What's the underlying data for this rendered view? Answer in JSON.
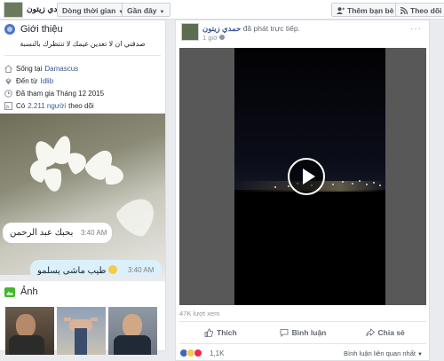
{
  "topbar": {
    "profile_name": "حمدي زيتون",
    "timeline_buttons": [
      "Dòng thời gian",
      "Gần đây"
    ],
    "add_friend": "Thêm bạn bè",
    "follow": "Theo dõi"
  },
  "intro": {
    "title": "Giới thiệu",
    "bio": "صدقني ان لا تعدين غيمك لا تنتظرك بالنسبة",
    "items": [
      {
        "icon": "house-icon",
        "prefix": "Sống tại",
        "link": "Damascus"
      },
      {
        "icon": "pin-icon",
        "prefix": "Đến từ",
        "link": "Idlib"
      },
      {
        "icon": "clock-icon",
        "prefix": "Đã tham gia Tháng 12 2015",
        "link": ""
      },
      {
        "icon": "rss-icon",
        "prefix": "Có",
        "link": "2.211 người",
        "suffix": "theo dõi"
      }
    ]
  },
  "photo_chat": [
    {
      "text": "بحبك عبد الرحمن",
      "time": "3:40 AM"
    },
    {
      "text": "طيب ماشي يسلمو",
      "time": "3:40 AM"
    }
  ],
  "photos": {
    "title": "Ảnh"
  },
  "post": {
    "author": "حمدي زيتون",
    "action": "đã phát trực tiếp.",
    "time": "1 giờ",
    "more": "···",
    "views": "47K lượt xem",
    "actions": [
      "Thích",
      "Bình luận",
      "Chia sẻ"
    ],
    "reaction_count": "1,1K",
    "comment_sort": "Bình luận liên quan nhất"
  },
  "colors": {
    "accent": "#4267b2",
    "link": "#385898",
    "background": "#e9ebee"
  }
}
